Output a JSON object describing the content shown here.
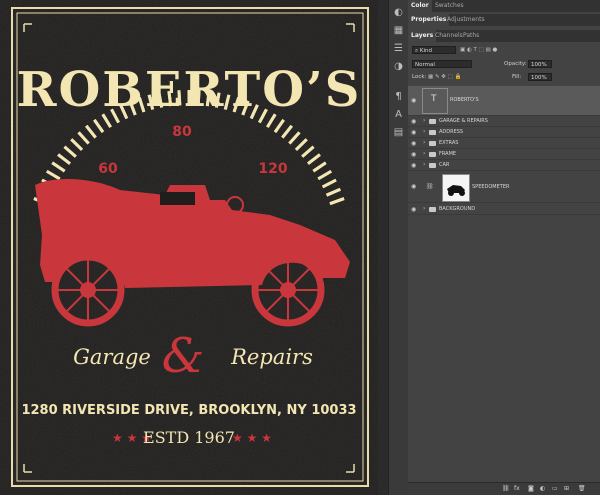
{
  "poster": {
    "title": "ROBERTO’S",
    "speed_low": "60",
    "speed_mid": "80",
    "speed_high": "120",
    "script_left": "Garage",
    "ampersand": "&",
    "script_right": "Repairs",
    "address": "1280 RIVERSIDE DRIVE, BROOKLYN, NY 10033",
    "established": "ESTD 1967",
    "stars": "★ ★ ★",
    "colors": {
      "cream": "#f3e6b3",
      "red": "#c9363b",
      "bg": "#1f1e1d"
    }
  },
  "panel": {
    "top_tabs": [
      "Color",
      "Swatches"
    ],
    "props_tabs": [
      "Properties",
      "Adjustments"
    ],
    "layer_tabs": [
      "Layers",
      "Channels",
      "Paths"
    ],
    "kind_label": "Kind",
    "blend_mode": "Normal",
    "opacity_label": "Opacity:",
    "opacity_value": "100%",
    "lock_label": "Lock:",
    "fill_label": "Fill:",
    "fill_value": "100%",
    "layers": [
      {
        "name": "ROBERTO'S",
        "type": "text"
      },
      {
        "name": "GARAGE & REPAIRS",
        "type": "group"
      },
      {
        "name": "ADDRESS",
        "type": "group"
      },
      {
        "name": "EXTRAS",
        "type": "group"
      },
      {
        "name": "FRAME",
        "type": "group"
      },
      {
        "name": "CAR",
        "type": "group"
      },
      {
        "name": "SPEEDOMETER",
        "type": "smart"
      },
      {
        "name": "BACKGROUND",
        "type": "group"
      }
    ],
    "footer_icons": [
      "link-icon",
      "fx-icon",
      "mask-icon",
      "adjustment-icon",
      "folder-icon",
      "new-layer-icon",
      "trash-icon"
    ]
  }
}
